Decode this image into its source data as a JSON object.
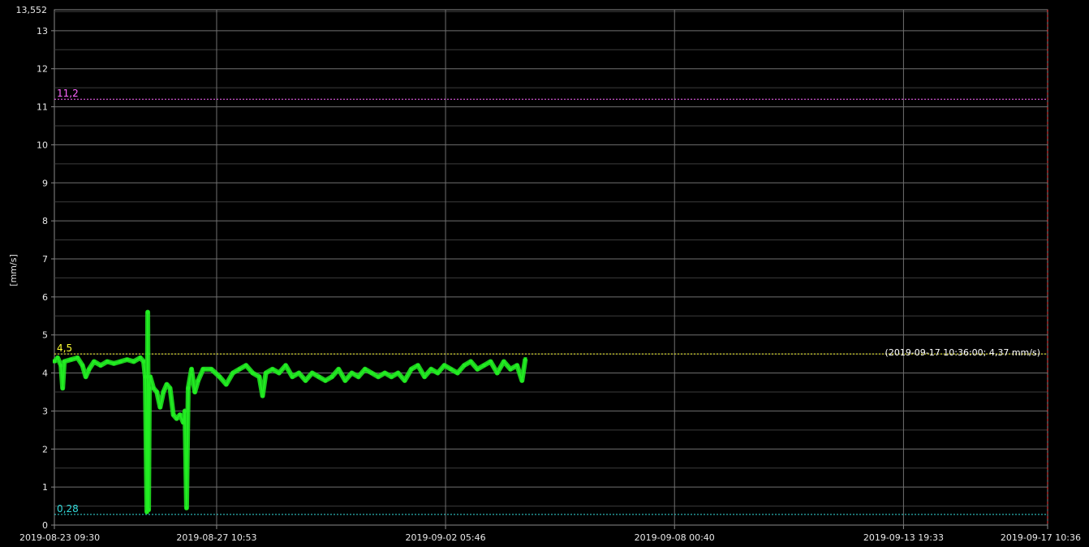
{
  "chart_data": {
    "type": "line",
    "title": "",
    "xlabel": "",
    "ylabel": "[mm/s]",
    "ylim": [
      0,
      13.552
    ],
    "y_ticks": [
      0,
      1,
      2,
      3,
      4,
      5,
      6,
      7,
      8,
      9,
      10,
      11,
      12,
      13
    ],
    "y_max_label": "13,552",
    "x_ticks": [
      "2019-08-23 09:30",
      "2019-08-27 10:53",
      "2019-09-02 05:46",
      "2019-09-08 00:40",
      "2019-09-13 19:33",
      "2019-09-17 10:36"
    ],
    "grid": true,
    "series_color": "#22ee22",
    "thresholds": [
      {
        "value": 11.2,
        "label": "11,2",
        "color": "#ff66ff"
      },
      {
        "value": 4.5,
        "label": "4,5",
        "color": "#ffff33"
      },
      {
        "value": 0.28,
        "label": "0,28",
        "color": "#33dddd"
      }
    ],
    "annotation": "(2019-09-17 10:36:00; 4,37 mm/s)",
    "series": [
      {
        "values": [
          [
            0,
            4.3
          ],
          [
            2,
            4.4
          ],
          [
            4,
            4.2
          ],
          [
            5,
            3.6
          ],
          [
            6,
            4.3
          ],
          [
            10,
            4.35
          ],
          [
            14,
            4.4
          ],
          [
            17,
            4.2
          ],
          [
            19,
            3.9
          ],
          [
            21,
            4.1
          ],
          [
            24,
            4.3
          ],
          [
            28,
            4.2
          ],
          [
            32,
            4.3
          ],
          [
            36,
            4.25
          ],
          [
            40,
            4.3
          ],
          [
            44,
            4.35
          ],
          [
            48,
            4.3
          ],
          [
            52,
            4.4
          ],
          [
            54,
            4.3
          ],
          [
            55,
            3.9
          ],
          [
            56,
            0.35
          ],
          [
            56.5,
            5.6
          ],
          [
            57,
            0.4
          ],
          [
            57.5,
            3.6
          ],
          [
            58,
            3.9
          ],
          [
            60,
            3.6
          ],
          [
            62,
            3.5
          ],
          [
            64,
            3.1
          ],
          [
            66,
            3.5
          ],
          [
            68,
            3.7
          ],
          [
            70,
            3.6
          ],
          [
            72,
            2.9
          ],
          [
            74,
            2.8
          ],
          [
            76,
            2.9
          ],
          [
            78,
            2.7
          ],
          [
            79,
            3.0
          ],
          [
            80,
            0.45
          ],
          [
            81,
            3.6
          ],
          [
            83,
            4.1
          ],
          [
            85,
            3.5
          ],
          [
            87,
            3.8
          ],
          [
            90,
            4.1
          ],
          [
            95,
            4.1
          ],
          [
            100,
            3.9
          ],
          [
            104,
            3.7
          ],
          [
            108,
            4.0
          ],
          [
            112,
            4.1
          ],
          [
            116,
            4.2
          ],
          [
            120,
            4.0
          ],
          [
            124,
            3.9
          ],
          [
            126,
            3.4
          ],
          [
            128,
            4.0
          ],
          [
            132,
            4.1
          ],
          [
            136,
            4.0
          ],
          [
            140,
            4.2
          ],
          [
            144,
            3.9
          ],
          [
            148,
            4.0
          ],
          [
            152,
            3.8
          ],
          [
            156,
            4.0
          ],
          [
            160,
            3.9
          ],
          [
            164,
            3.8
          ],
          [
            168,
            3.9
          ],
          [
            172,
            4.1
          ],
          [
            176,
            3.8
          ],
          [
            180,
            4.0
          ],
          [
            184,
            3.9
          ],
          [
            188,
            4.1
          ],
          [
            192,
            4.0
          ],
          [
            196,
            3.9
          ],
          [
            200,
            4.0
          ],
          [
            204,
            3.9
          ],
          [
            208,
            4.0
          ],
          [
            212,
            3.8
          ],
          [
            216,
            4.1
          ],
          [
            220,
            4.2
          ],
          [
            224,
            3.9
          ],
          [
            228,
            4.1
          ],
          [
            232,
            4.0
          ],
          [
            236,
            4.2
          ],
          [
            240,
            4.1
          ],
          [
            244,
            4.0
          ],
          [
            248,
            4.2
          ],
          [
            252,
            4.3
          ],
          [
            256,
            4.1
          ],
          [
            260,
            4.2
          ],
          [
            264,
            4.3
          ],
          [
            268,
            4.0
          ],
          [
            272,
            4.3
          ],
          [
            276,
            4.1
          ],
          [
            280,
            4.2
          ],
          [
            283,
            3.8
          ],
          [
            285.04,
            4.37
          ]
        ]
      }
    ]
  }
}
